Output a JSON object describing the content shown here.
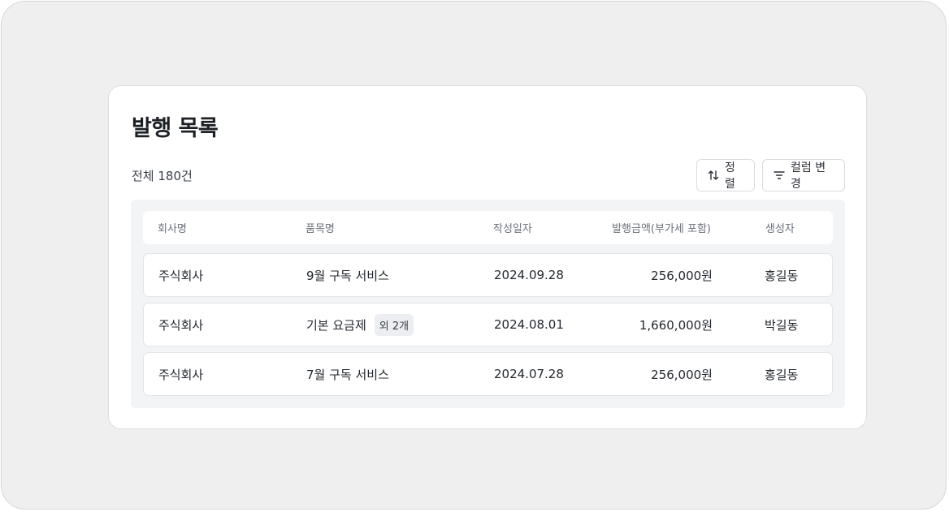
{
  "page": {
    "title": "발행 목록",
    "total": "전체 180건"
  },
  "toolbar": {
    "sort_label": "정렬",
    "sort_icon": "sort-arrows-icon",
    "columns_label": "컬럼 변경",
    "columns_icon": "filter-lines-icon"
  },
  "table": {
    "headers": [
      "회사명",
      "품목명",
      "작성일자",
      "발행금액(부가세 포함)",
      "생성자"
    ],
    "rows": [
      {
        "company": "주식회사",
        "item": "9월 구독 서비스",
        "badge": "",
        "date": "2024.09.28",
        "amount": "256,000원",
        "creator": "홍길동"
      },
      {
        "company": "주식회사",
        "item": "기본 요금제",
        "badge": "외 2개",
        "date": "2024.08.01",
        "amount": "1,660,000원",
        "creator": "박길동"
      },
      {
        "company": "주식회사",
        "item": "7월 구독 서비스",
        "badge": "",
        "date": "2024.07.28",
        "amount": "256,000원",
        "creator": "홍길동"
      }
    ]
  },
  "colors": {
    "frame_bg": "#efeff0",
    "card_bg": "#ffffff",
    "table_bg": "#f3f4f6",
    "text": "#1f2329",
    "muted": "#6b7079"
  }
}
